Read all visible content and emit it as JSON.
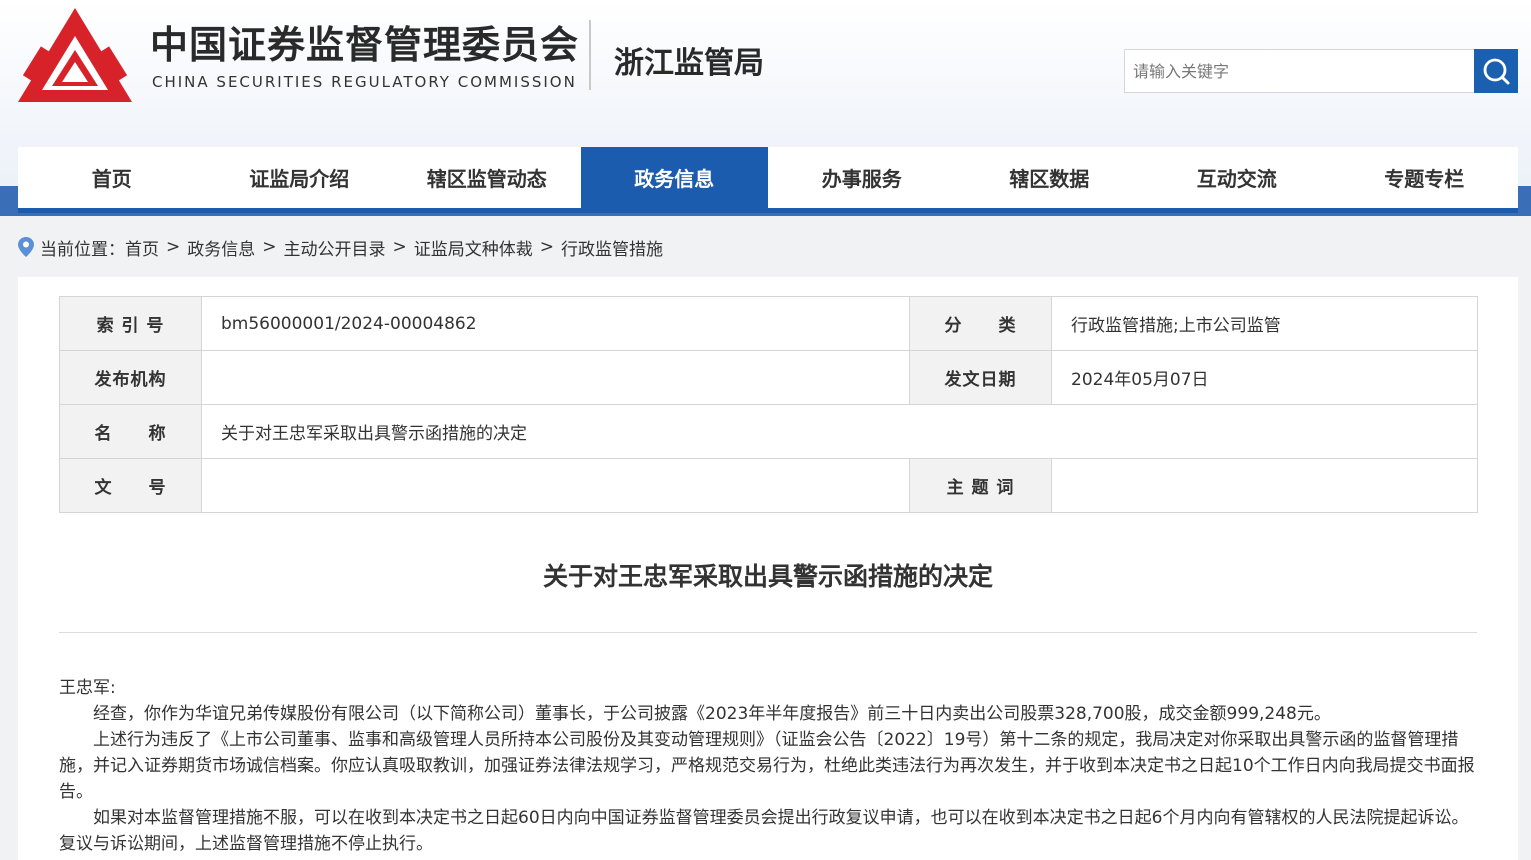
{
  "brand": {
    "name_cn": "中国证券监督管理委员会",
    "name_en": "CHINA SECURITIES REGULATORY COMMISSION",
    "bureau": "浙江监管局",
    "logo_color": "#d7222a"
  },
  "search": {
    "placeholder": "请输入关键字"
  },
  "nav": {
    "items": [
      {
        "label": "首页"
      },
      {
        "label": "证监局介绍"
      },
      {
        "label": "辖区监管动态"
      },
      {
        "label": "政务信息",
        "active": true
      },
      {
        "label": "办事服务"
      },
      {
        "label": "辖区数据"
      },
      {
        "label": "互动交流"
      },
      {
        "label": "专题专栏"
      }
    ]
  },
  "breadcrumb": {
    "prefix": "当前位置：",
    "items": [
      "首页",
      "政务信息",
      "主动公开目录",
      "证监局文种体裁",
      "行政监管措施"
    ],
    "separator": ">"
  },
  "meta": {
    "index_label": "索 引 号",
    "index_value": "bm56000001/2024-00004862",
    "category_label": "分　　类",
    "category_value": "行政监管措施;上市公司监管",
    "issuer_label": "发布机构",
    "issuer_value": "",
    "date_label": "发文日期",
    "date_value": "2024年05月07日",
    "name_label": "名　　称",
    "name_value": "关于对王忠军采取出具警示函措施的决定",
    "docno_label": "文　　号",
    "docno_value": "",
    "keywords_label": "主 题 词",
    "keywords_value": ""
  },
  "document": {
    "title": "关于对王忠军采取出具警示函措施的决定",
    "salutation": "王忠军:",
    "paragraphs": [
      "经查，你作为华谊兄弟传媒股份有限公司（以下简称公司）董事长，于公司披露《2023年半年度报告》前三十日内卖出公司股票328,700股，成交金额999,248元。",
      "上述行为违反了《上市公司董事、监事和高级管理人员所持本公司股份及其变动管理规则》（证监会公告〔2022〕19号）第十二条的规定，我局决定对你采取出具警示函的监督管理措施，并记入证券期货市场诚信档案。你应认真吸取教训，加强证券法律法规学习，严格规范交易行为，杜绝此类违法行为再次发生，并于收到本决定书之日起10个工作日内向我局提交书面报告。",
      "如果对本监督管理措施不服，可以在收到本决定书之日起60日内向中国证券监督管理委员会提出行政复议申请，也可以在收到本决定书之日起6个月内向有管辖权的人民法院提起诉讼。复议与诉讼期间，上述监督管理措施不停止执行。"
    ]
  },
  "colors": {
    "accent": "#1c5caf",
    "strip": "#3a6fb7",
    "search_button": "#1b5fb0"
  }
}
